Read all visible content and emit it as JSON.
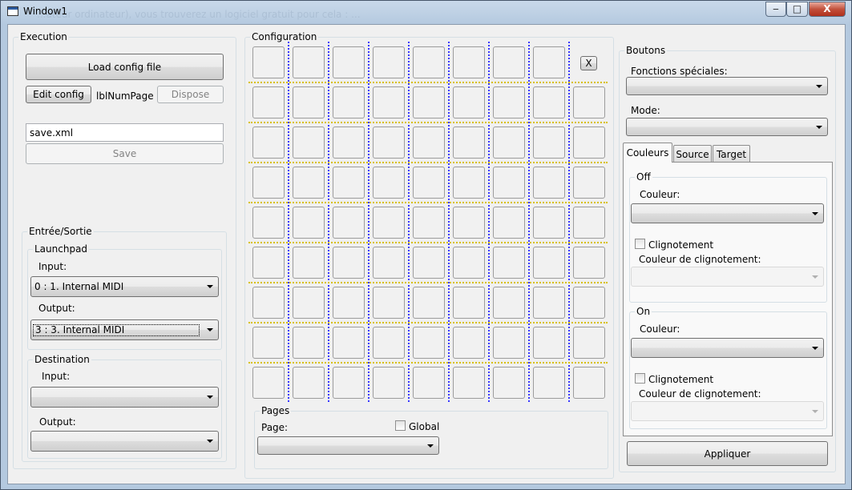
{
  "window": {
    "title": "Window1",
    "background_text": "...ateur ordinateur), vous trouverez un logiciel gratuit pour cela : ...",
    "minimize": "‒",
    "maximize": "□",
    "close": "X"
  },
  "execution": {
    "legend": "Execution",
    "load_config": "Load config file",
    "edit_config": "Edit config",
    "num_page_label": "lblNumPage",
    "dispose": "Dispose",
    "save_file": "save.xml",
    "save": "Save"
  },
  "io": {
    "legend": "Entrée/Sortie",
    "launchpad": {
      "legend": "Launchpad",
      "input_label": "Input:",
      "input_value": "0 : 1. Internal MIDI",
      "output_label": "Output:",
      "output_value": "3 : 3. Internal MIDI"
    },
    "destination": {
      "legend": "Destination",
      "input_label": "Input:",
      "input_value": "",
      "output_label": "Output:",
      "output_value": ""
    }
  },
  "configuration": {
    "legend": "Configuration",
    "close_label": "X",
    "rows": 9,
    "cols": 9,
    "pages": {
      "legend": "Pages",
      "page_label": "Page:",
      "global_label": "Global",
      "page_value": ""
    }
  },
  "boutons": {
    "legend": "Boutons",
    "fonctions_label": "Fonctions spéciales:",
    "fonctions_value": "",
    "mode_label": "Mode:",
    "mode_value": "",
    "tabs": [
      {
        "label": "Couleurs"
      },
      {
        "label": "Source"
      },
      {
        "label": "Target"
      }
    ],
    "off": {
      "legend": "Off",
      "couleur_label": "Couleur:",
      "clignotement_label": "Clignotement",
      "couleur_clig_label": "Couleur de clignotement:"
    },
    "on": {
      "legend": "On",
      "couleur_label": "Couleur:",
      "clignotement_label": "Clignotement",
      "couleur_clig_label": "Couleur de clignotement:"
    },
    "appliquer": "Appliquer"
  }
}
